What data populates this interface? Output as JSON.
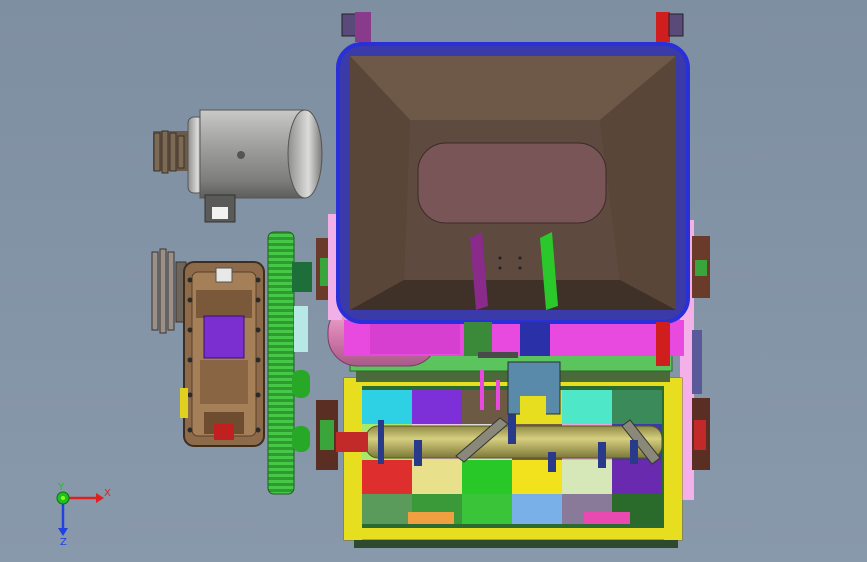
{
  "viewport": {
    "background": "#8797aa"
  },
  "triad": {
    "x_label": "X",
    "y_label": "Y",
    "z_label": "Z",
    "x_color": "#e02020",
    "y_color": "#20c020",
    "z_color": "#2040e0"
  },
  "colors": {
    "hopper_rim": "#2a30d8",
    "hopper_inner": "#5e4a3e",
    "hopper_floor": "#7a5558",
    "motor_body": "#9a9a98",
    "gear_green": "#3fb53f",
    "gearbox": "#8a6a48",
    "frame_yellow": "#e8e020",
    "frame_green": "#4cc44c",
    "magenta": "#e040e0",
    "shaft": "#b8b060"
  }
}
